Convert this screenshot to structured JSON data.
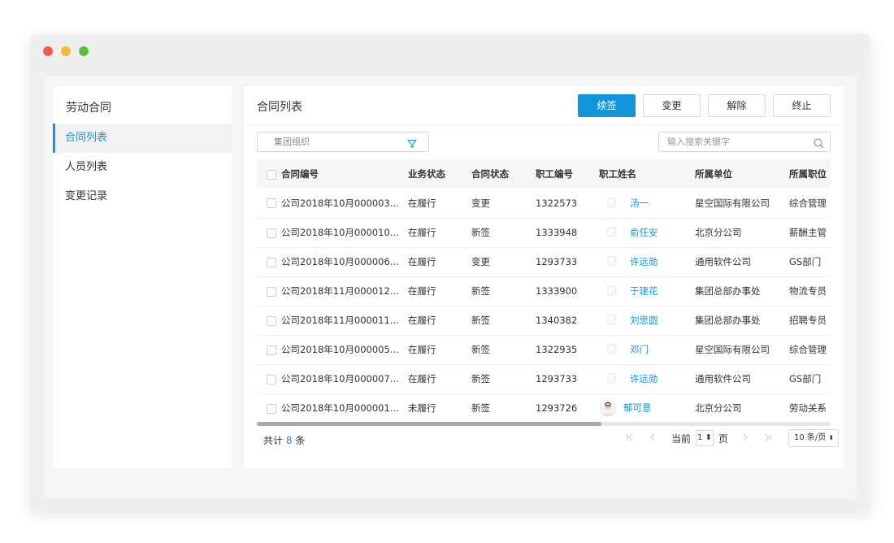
{
  "sidebar": {
    "title": "劳动合同",
    "items": [
      {
        "label": "合同列表"
      },
      {
        "label": "人员列表"
      },
      {
        "label": "变更记录"
      }
    ]
  },
  "main": {
    "title": "合同列表",
    "buttons": {
      "renew": "续签",
      "change": "变更",
      "release": "解除",
      "terminate": "终止"
    },
    "filter_placeholder": "集团组织",
    "search_placeholder": "输入搜索关键字",
    "table": {
      "headers": [
        "合同编号",
        "业务状态",
        "合同状态",
        "职工编号",
        "职工姓名",
        "所属单位",
        "所属职位"
      ],
      "rows": [
        {
          "contract": "公司2018年10月000003...",
          "biz": "在履行",
          "status": "变更",
          "emp_no": "1322573",
          "name": "汤一",
          "unit": "星空国际有限公司",
          "position": "综合管理"
        },
        {
          "contract": "公司2018年10月000010...",
          "biz": "在履行",
          "status": "新签",
          "emp_no": "1333948",
          "name": "俞任安",
          "unit": "北京分公司",
          "position": "薪酬主管"
        },
        {
          "contract": "公司2018年10月000006...",
          "biz": "在履行",
          "status": "变更",
          "emp_no": "1293733",
          "name": "许远勋",
          "unit": "通用软件公司",
          "position": "GS部门"
        },
        {
          "contract": "公司2018年11月000012...",
          "biz": "在履行",
          "status": "新签",
          "emp_no": "1333900",
          "name": "于建花",
          "unit": "集团总部办事处",
          "position": "物流专员"
        },
        {
          "contract": "公司2018年11月000011...",
          "biz": "在履行",
          "status": "新签",
          "emp_no": "1340382",
          "name": "刘思圆",
          "unit": "集团总部办事处",
          "position": "招聘专员"
        },
        {
          "contract": "公司2018年10月000005...",
          "biz": "在履行",
          "status": "新签",
          "emp_no": "1322935",
          "name": "邓门",
          "unit": "星空国际有限公司",
          "position": "综合管理"
        },
        {
          "contract": "公司2018年10月000007...",
          "biz": "在履行",
          "status": "新签",
          "emp_no": "1293733",
          "name": "许远勋",
          "unit": "通用软件公司",
          "position": "GS部门"
        },
        {
          "contract": "公司2018年10月000001...",
          "biz": "未履行",
          "status": "新签",
          "emp_no": "1293726",
          "name": "郁可意",
          "unit": "北京分公司",
          "position": "劳动关系"
        }
      ]
    },
    "footer": {
      "total_prefix": "共计",
      "total_count": "8",
      "total_suffix": "条",
      "current_label": "当前",
      "current_page": "1",
      "page_suffix": "页",
      "page_size": "10 条/页"
    }
  },
  "colors": {
    "accent": "#1296db"
  }
}
